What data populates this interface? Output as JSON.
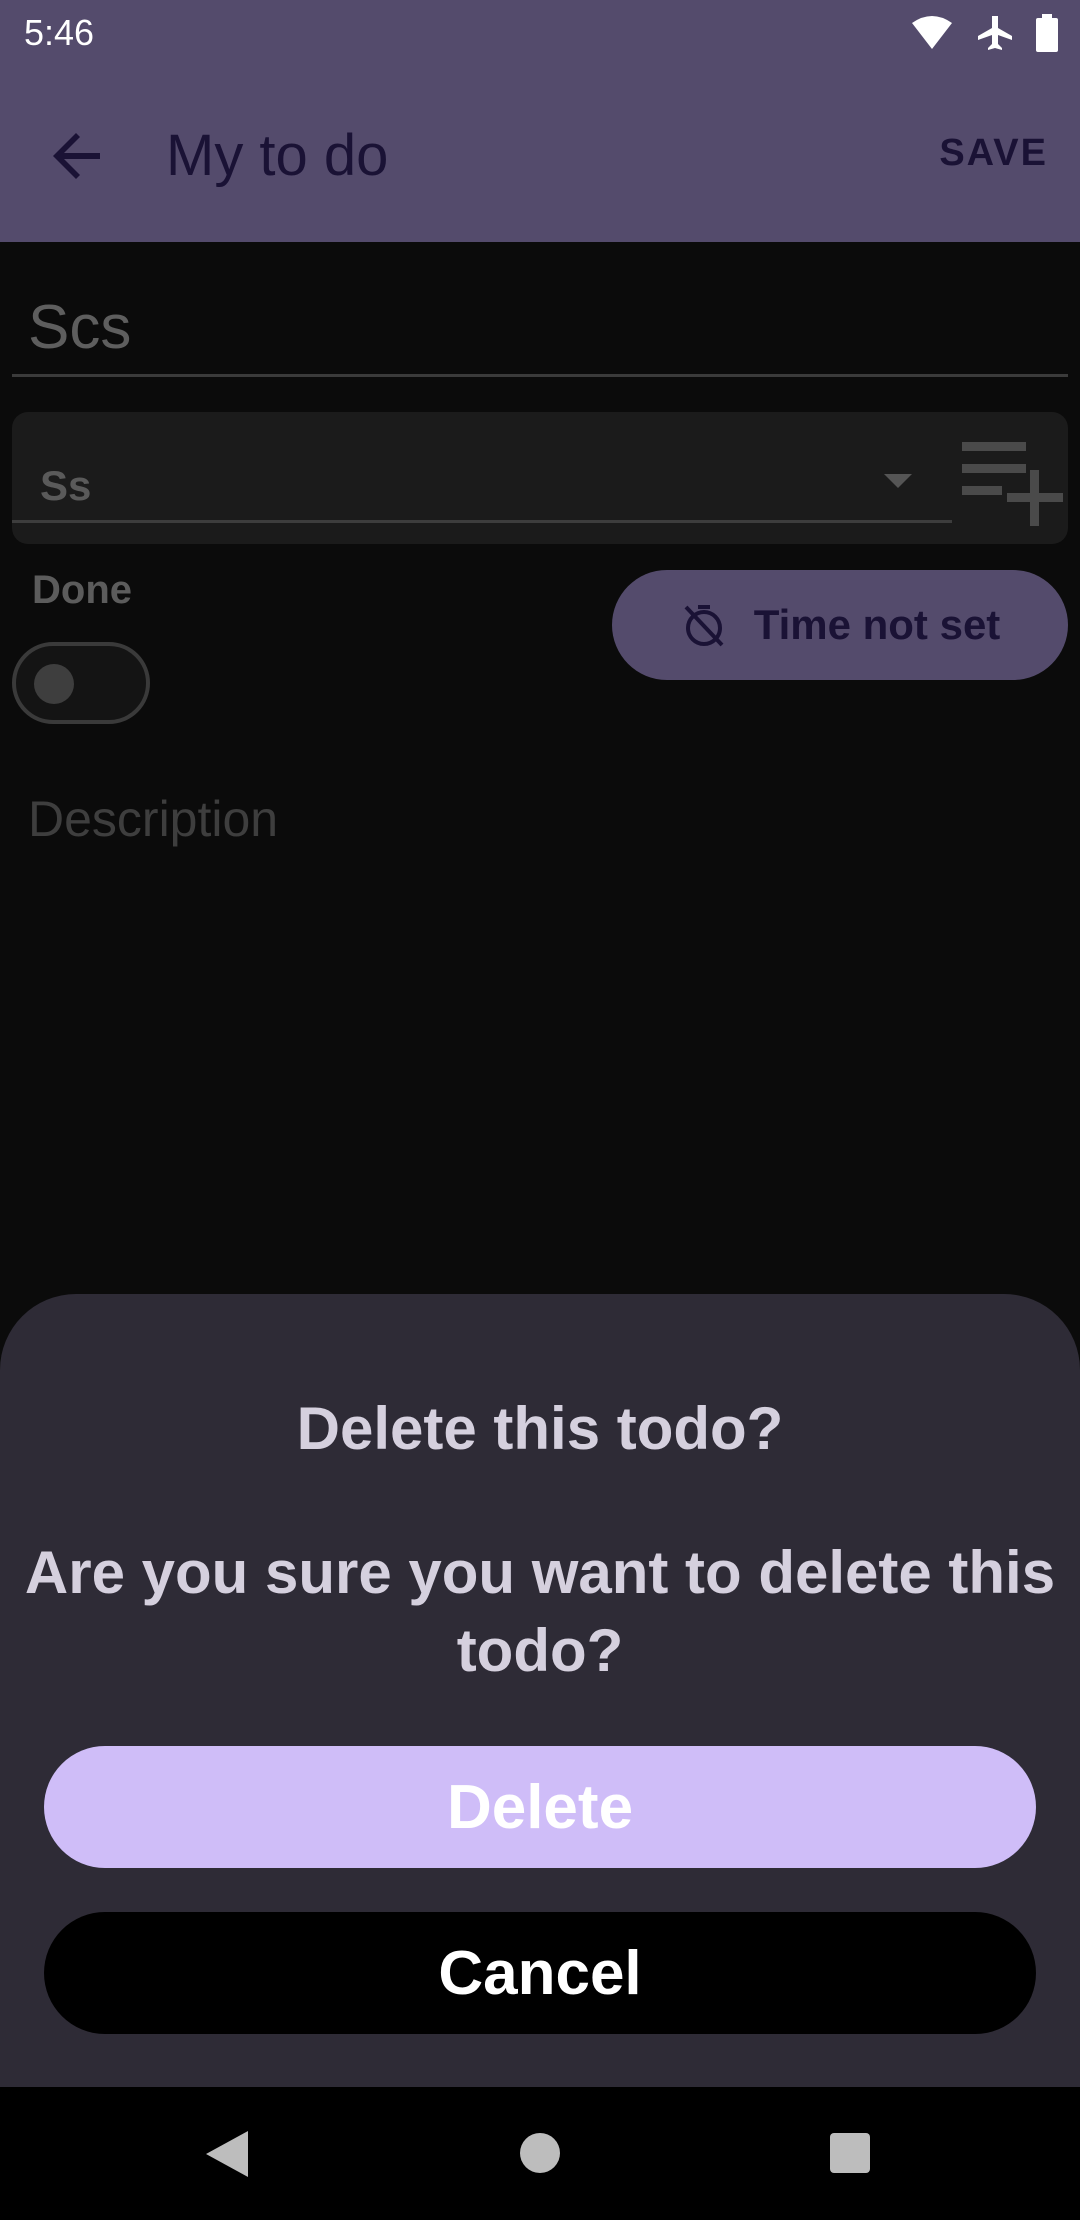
{
  "status_bar": {
    "time": "5:46",
    "icons": [
      "wifi-icon",
      "airplane-icon",
      "battery-icon"
    ]
  },
  "app_bar": {
    "title": "My to do",
    "back_icon": "arrow-back-icon",
    "save_label": "SAVE"
  },
  "form": {
    "title_value": "Scs",
    "category_value": "Ss",
    "done_label": "Done",
    "done_checked": false,
    "time_button_label": "Time not set",
    "description_placeholder": "Description"
  },
  "dialog": {
    "title": "Delete this todo?",
    "message": "Are you sure you want to delete this todo?",
    "delete_label": "Delete",
    "cancel_label": "Cancel"
  },
  "colors": {
    "app_bar": "#544b6c",
    "sheet": "#2e2b36",
    "delete_button": "#cfbdf8",
    "cancel_button": "#000000"
  }
}
